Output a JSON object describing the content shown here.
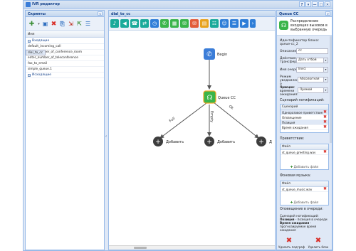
{
  "window": {
    "title": "IVR редактор",
    "buttons": [
      "?",
      "▾",
      "—",
      "□",
      "✕"
    ]
  },
  "left_panel": {
    "title": "Скрипты",
    "column_header": "Имя",
    "groups": [
      {
        "label": "Входящие",
        "items": [
          "default_incoming_call",
          "dial_to_cc",
          "enter_number_of_conference_room",
          "enter_number_of_teleconference",
          "fax_to_email",
          "simple_queue.1"
        ],
        "selected": "dial_to_cc"
      },
      {
        "label": "Исходящие",
        "items": []
      }
    ]
  },
  "center_panel": {
    "title": "dial_to_cc",
    "toolbar_icons": [
      "mic",
      "speaker",
      "phone",
      "transfer",
      "clock",
      "call",
      "grid",
      "sms",
      "email",
      "web",
      "group",
      "contact",
      "menu",
      "queue"
    ],
    "nodes": {
      "begin": "Begin",
      "queue": "Queue CC",
      "add1": "Добавить",
      "add2": "Добавить",
      "add3": "Д"
    },
    "edges": {
      "left": "Full",
      "middle": "Empty",
      "right": "Ok"
    }
  },
  "right_panel": {
    "title": "Queue CC",
    "description": "Распределение входящих вызовов в выбранную очередь",
    "block_id_label": "Идентификатор блока: queue-cc_2",
    "description_label": "Описание:",
    "description_value": "cc",
    "action_label": "Действие трансфера",
    "action_value": "Дать отбой",
    "queue_label": "Имя очереди:",
    "queue_value": "line1",
    "notify_mode_label": "Режим уведомления о позиции:",
    "notify_mode_value": "Абсолютная",
    "wait_label": "Прогноз времени ожидания:",
    "wait_value": "Прямой",
    "scenario_header": "Сценарий нотификаций:",
    "scenario_col": "Сценарий",
    "scenario_rows": [
      "Одноразовое приветствие",
      "Оповещение",
      "Позиция",
      "Время ожидания"
    ],
    "greeting_header": "Приветствие:",
    "file_col": "Файл",
    "greeting_file": "st_queue_greeting.wav",
    "add_file": "Добавить файл",
    "music_header": "Фоновая музыка:",
    "music_file": "st_queue_music.wav",
    "add_file2": "Добавить файл",
    "alert_header": "Оповещение в очереди:",
    "note_line1": "Сценарий нотификаций:",
    "note_pos_bold": "Позиция",
    "note_pos_rest": " - позиция в очереди",
    "note_wait_bold": "Время ожидания",
    "note_wait_rest": " - прогнозируемое время ожидания",
    "delete_sub": "Удалить подграф",
    "delete_block": "Удалить блок"
  },
  "colors": {
    "accent": "#15428b",
    "panel_bg": "#dfe8f6",
    "node_green": "#3ab54a",
    "node_blue": "#3b7dd8",
    "delete_red": "#d9302a",
    "toolbar_teal": "#1aaa9a"
  }
}
